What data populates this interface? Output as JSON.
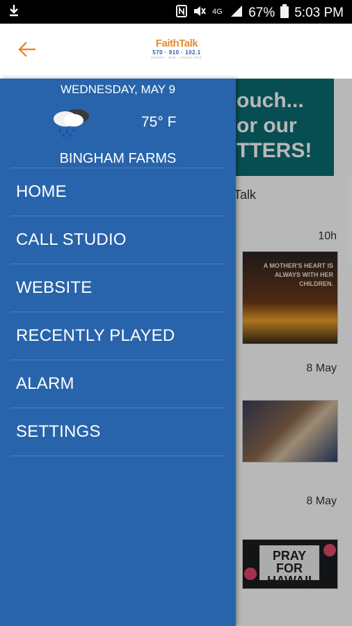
{
  "status_bar": {
    "battery": "67%",
    "time": "5:03 PM",
    "icons": [
      "download-icon",
      "nfc-icon",
      "mute-icon",
      "data-icon",
      "signal-icon",
      "battery-icon"
    ]
  },
  "header": {
    "back_icon": "arrow-left-icon",
    "logo": {
      "brand": "FaithTalk",
      "frequencies": "570 · 910 · 102.1",
      "tagline": "SHARE · MIN · LOCALIZED"
    }
  },
  "drawer": {
    "date": "WEDNESDAY, MAY 9",
    "weather_icon": "rain-cloud-icon",
    "temperature": "75° F",
    "location": "BINGHAM FARMS",
    "menu": [
      {
        "label": "HOME"
      },
      {
        "label": "CALL STUDIO"
      },
      {
        "label": "WEBSITE"
      },
      {
        "label": "RECENTLY PLAYED"
      },
      {
        "label": "ALARM"
      },
      {
        "label": "SETTINGS"
      }
    ]
  },
  "background": {
    "banner_lines": [
      "ouch...",
      "or our",
      "TTERS!"
    ],
    "feed_title": "Talk",
    "posts": [
      {
        "time": "10h",
        "image_text": "A MOTHER'S HEART IS ALWAYS WITH HER CHILDREN."
      },
      {
        "time": "8 May"
      },
      {
        "time": "8 May",
        "image_text": "PRAY FOR HAWAII"
      }
    ]
  },
  "colors": {
    "drawer_bg": "#2864ab",
    "accent": "#e88a2a",
    "status_bar_bg": "#000000"
  }
}
